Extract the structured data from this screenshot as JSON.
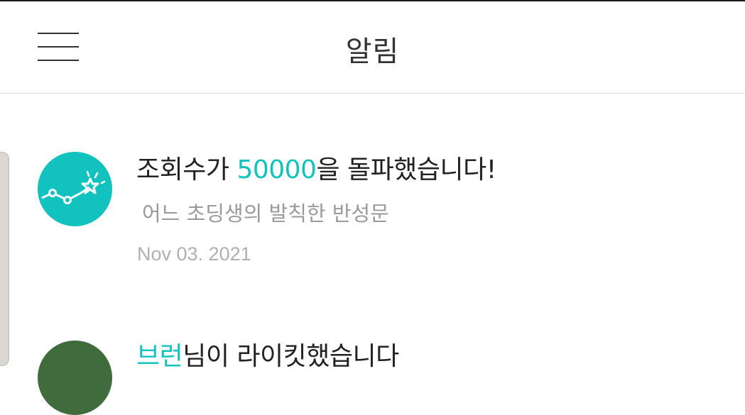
{
  "header": {
    "title": "알림",
    "menu_icon": "hamburger-menu-icon"
  },
  "notifications": [
    {
      "icon": "views-milestone-star-icon",
      "icon_color": "#12c2bf",
      "message_prefix": "조회수가 ",
      "message_highlight": "50000",
      "message_suffix": "을 돌파했습니다!",
      "subtitle": "어느 초딩생의 발칙한 반성문",
      "date": "Nov 03. 2021"
    },
    {
      "icon": "user-avatar",
      "message_highlight": "브런",
      "message_suffix": "님이 라이킷했습니다"
    }
  ],
  "colors": {
    "accent": "#12c2bf",
    "primary_text": "#222222",
    "secondary_text": "#9a9a9a",
    "date_text": "#b0b0b0"
  }
}
